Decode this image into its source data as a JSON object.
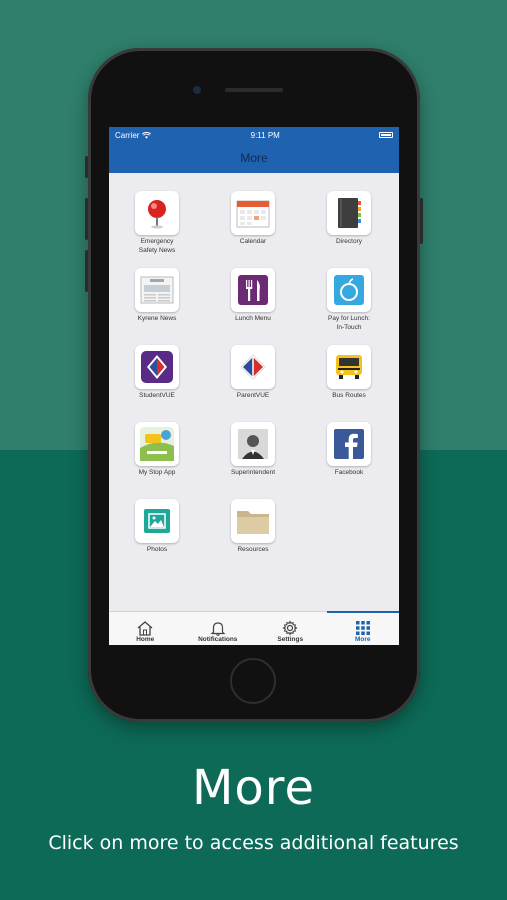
{
  "status": {
    "carrier": "Carrier",
    "time": "9:11 PM"
  },
  "navbar": {
    "title": "More"
  },
  "tiles": [
    {
      "label": "Emergency\nSafety News",
      "icon": "emergency-pin-icon"
    },
    {
      "label": "Calendar",
      "icon": "calendar-icon"
    },
    {
      "label": "Directory",
      "icon": "directory-book-icon"
    },
    {
      "label": "Kyrene News",
      "icon": "newspaper-icon"
    },
    {
      "label": "Lunch Menu",
      "icon": "fork-knife-icon"
    },
    {
      "label": "Pay for Lunch:\nIn-Touch",
      "icon": "apple-icon"
    },
    {
      "label": "StudentVUE",
      "icon": "studentvue-icon"
    },
    {
      "label": "ParentVUE",
      "icon": "parentvue-icon"
    },
    {
      "label": "Bus Routes",
      "icon": "school-bus-icon"
    },
    {
      "label": "My Stop App",
      "icon": "my-stop-app-icon"
    },
    {
      "label": "Superintendent",
      "icon": "person-photo-icon"
    },
    {
      "label": "Facebook",
      "icon": "facebook-icon"
    },
    {
      "label": "Photos",
      "icon": "photos-icon"
    },
    {
      "label": "Resources",
      "icon": "folder-icon"
    }
  ],
  "tabs": [
    {
      "label": "Home",
      "icon": "home-icon"
    },
    {
      "label": "Notifications",
      "icon": "bell-icon"
    },
    {
      "label": "Settings",
      "icon": "gear-icon"
    },
    {
      "label": "More",
      "icon": "grid-icon",
      "active": true
    }
  ],
  "caption": {
    "title": "More",
    "subtitle": "Click on more to access additional features"
  },
  "colors": {
    "accent": "#1e62b0",
    "background_top": "#2f7f6c",
    "background_bottom": "#0d6a57"
  }
}
